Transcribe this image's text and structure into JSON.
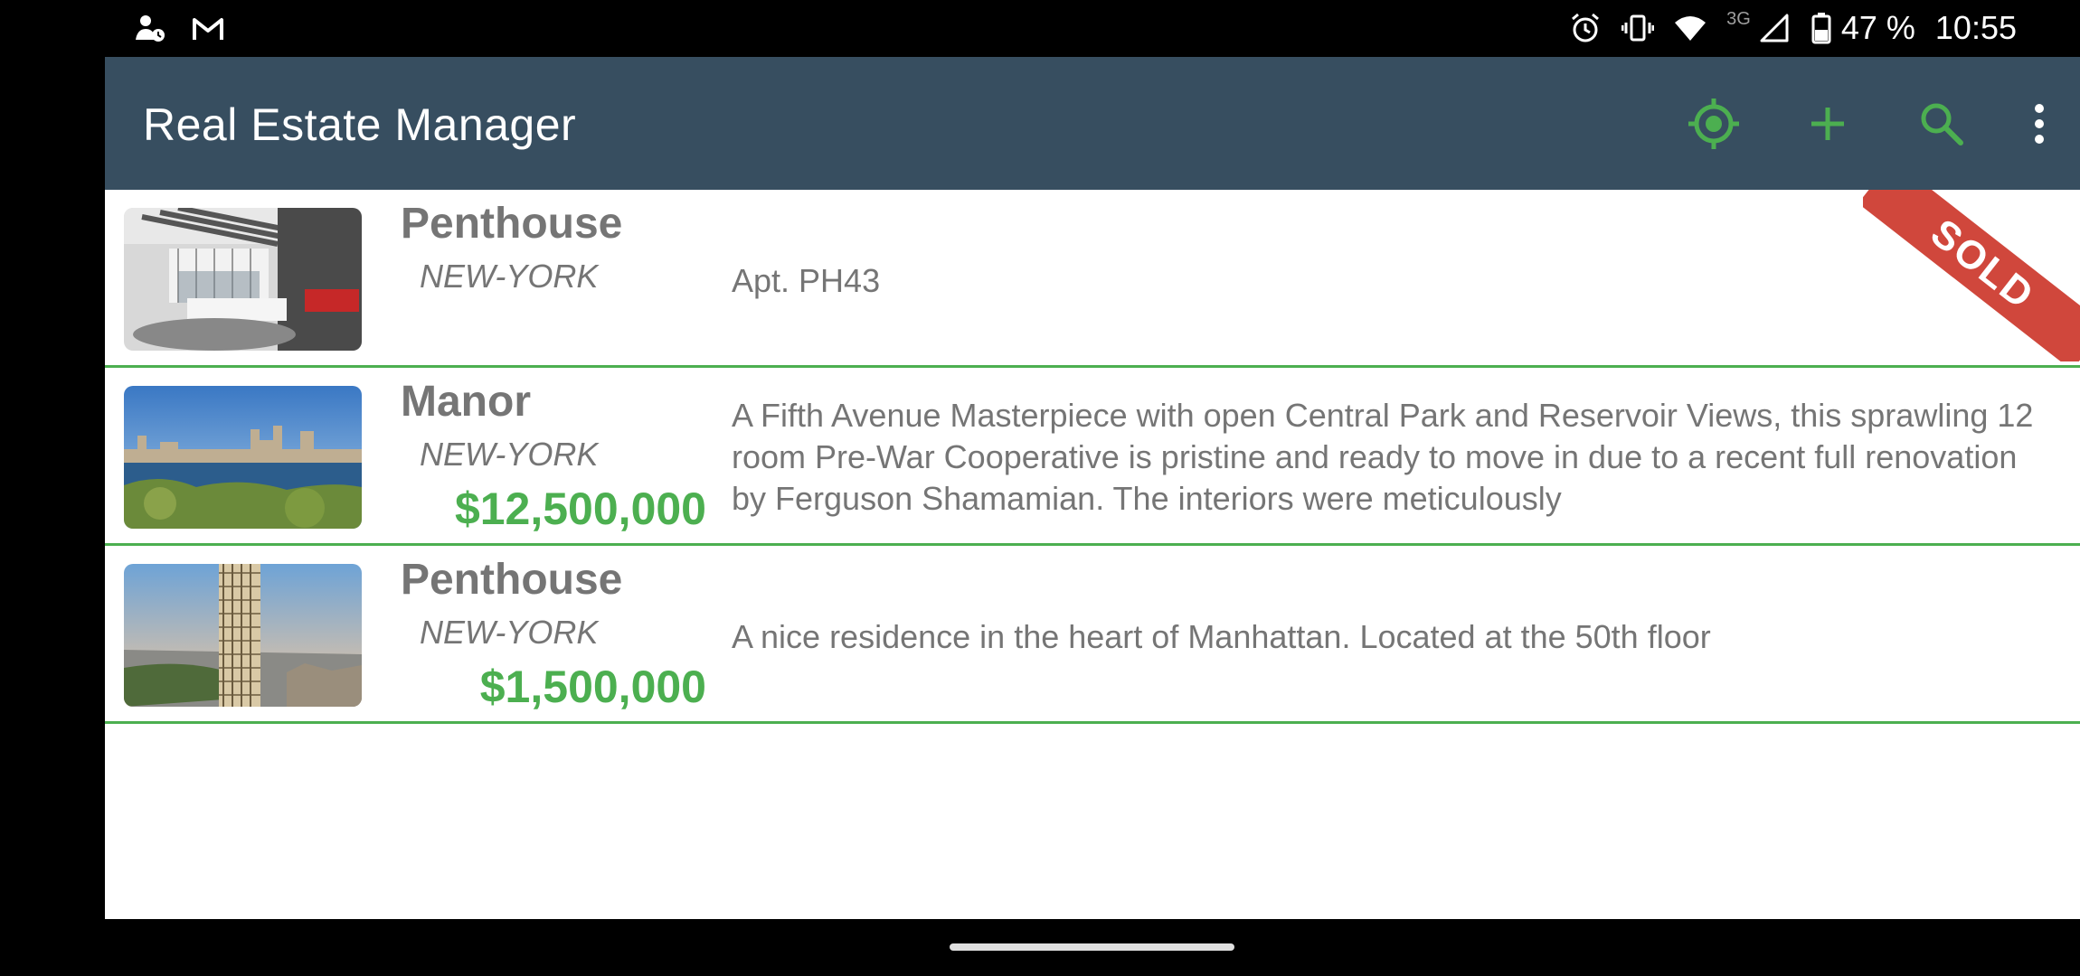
{
  "status_bar": {
    "battery": "47 %",
    "time": "10:55",
    "network": "3G"
  },
  "toolbar": {
    "title": "Real Estate Manager",
    "actions": [
      "location-icon",
      "add-icon",
      "search-icon",
      "more-vert-icon"
    ]
  },
  "colors": {
    "toolbar": "#374e60",
    "accent": "#4caf50",
    "sold_ribbon": "#d0473c"
  },
  "listings": [
    {
      "type": "Penthouse",
      "city": "NEW-YORK",
      "price": "",
      "description": "Apt. PH43",
      "badge": "SOLD"
    },
    {
      "type": "Manor",
      "city": "NEW-YORK",
      "price": "$12,500,000",
      "description": "A Fifth Avenue Masterpiece with open Central Park and Reservoir Views, this sprawling 12 room Pre-War Cooperative is pristine and ready to move in due to a recent full renovation by Ferguson Shamamian. The interiors were meticulously"
    },
    {
      "type": "Penthouse",
      "city": "NEW-YORK",
      "price": "$1,500,000",
      "description": "A nice residence in the heart of Manhattan. Located at the 50th floor"
    }
  ]
}
